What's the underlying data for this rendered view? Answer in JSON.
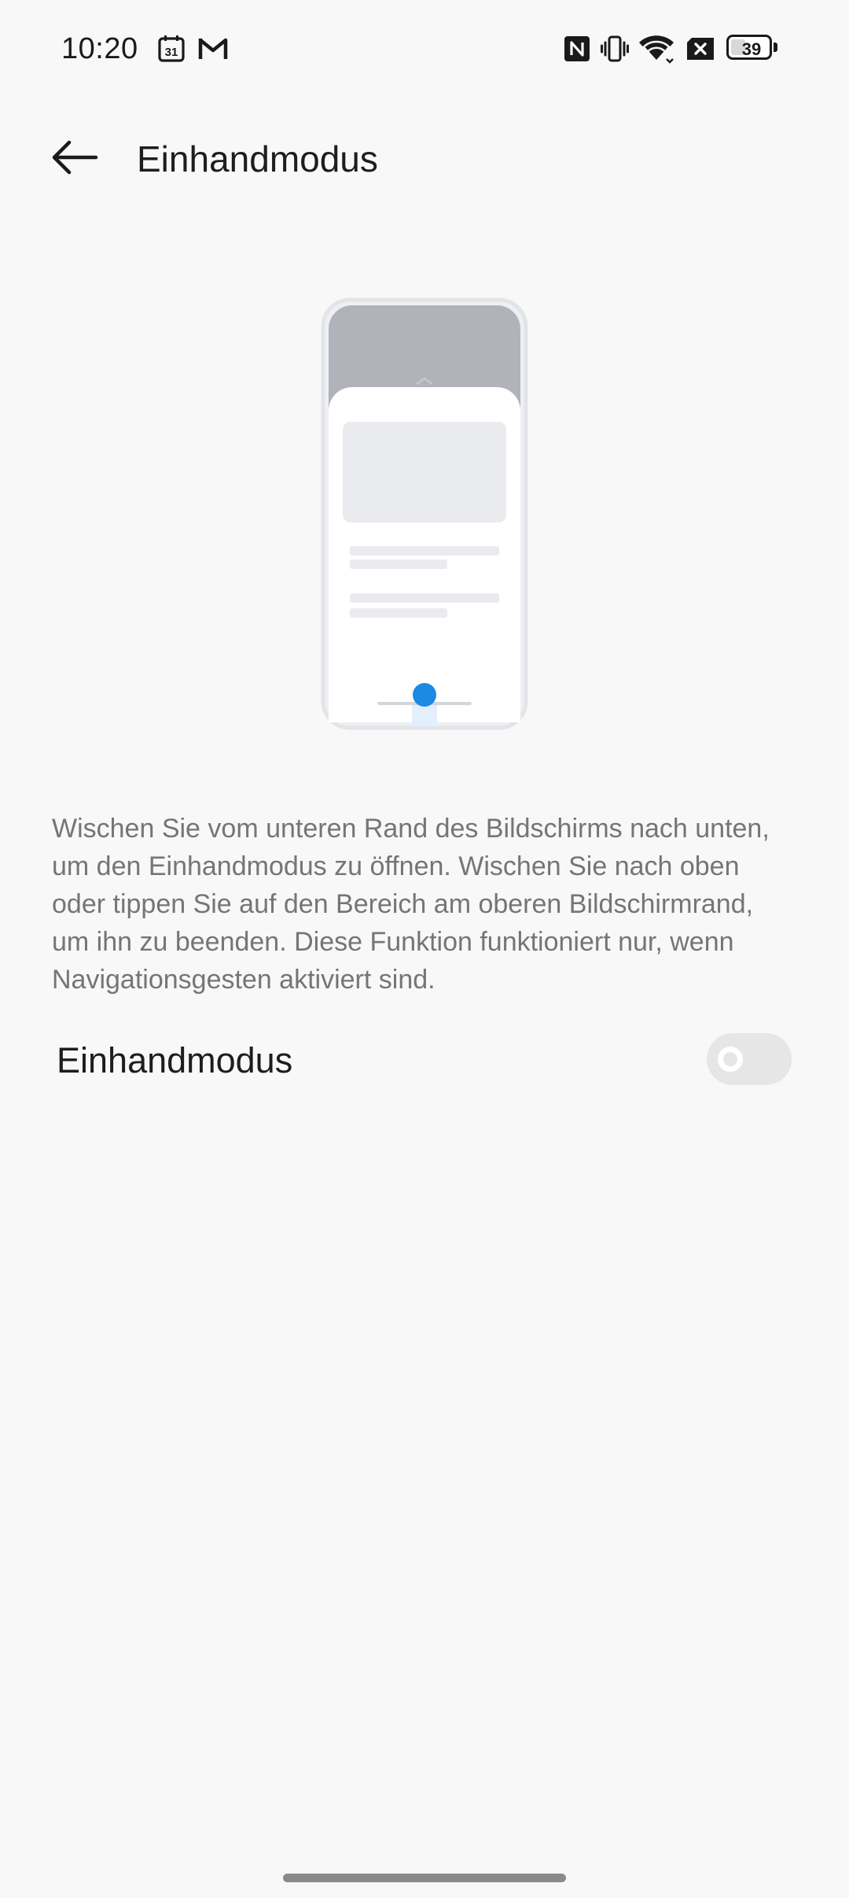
{
  "status_bar": {
    "time": "10:20",
    "calendar_icon_text": "31",
    "notification_icons": [
      "calendar-icon",
      "gmail-icon"
    ],
    "system_icons": [
      "nfc-icon",
      "vibrate-icon",
      "wifi-icon",
      "no-sim-icon",
      "battery-icon"
    ],
    "battery_level": "39",
    "battery_fraction": 0.39
  },
  "header": {
    "back_icon": "arrow-left-icon",
    "title": "Einhandmodus"
  },
  "illustration": {
    "icon": "one-handed-mode-illustration",
    "accent_color": "#1e88e5"
  },
  "description": "Wischen Sie vom unteren Rand des Bildschirms nach unten, um den Einhandmodus zu öffnen. Wischen Sie nach oben oder tippen Sie auf den Bereich am oberen Bildschirmrand, um ihn zu beenden. Diese Funktion funktioniert nur, wenn Navigationsgesten aktiviert sind.",
  "setting": {
    "label": "Einhandmodus",
    "enabled": false
  },
  "colors": {
    "background": "#f8f8f8",
    "text_primary": "#1d1d1d",
    "text_secondary": "#757575",
    "toggle_off": "#e6e6e6",
    "accent": "#1e88e5"
  }
}
